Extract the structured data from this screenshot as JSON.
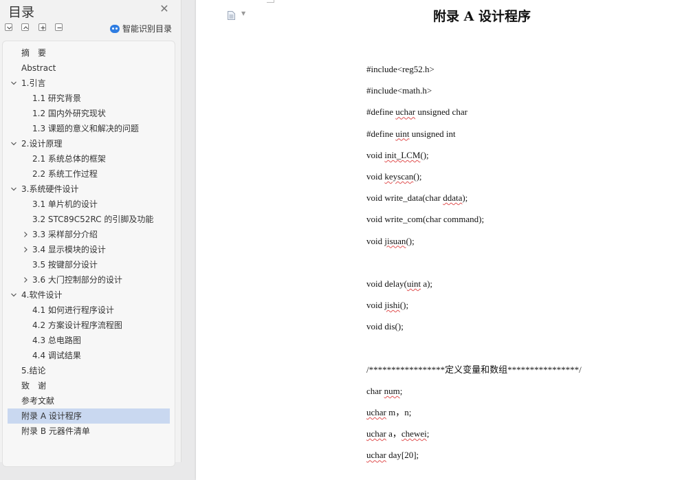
{
  "sidebar": {
    "title": "目录",
    "ai_label": "智能识别目录",
    "toc": [
      {
        "label": "摘　要",
        "level": 0,
        "chevron": ""
      },
      {
        "label": "Abstract",
        "level": 0,
        "chevron": ""
      },
      {
        "label": "1.引言",
        "level": 0,
        "chevron": "down"
      },
      {
        "label": "1.1  研究背景",
        "level": 1,
        "chevron": ""
      },
      {
        "label": "1.2  国内外研究现状",
        "level": 1,
        "chevron": ""
      },
      {
        "label": "1.3  课题的意义和解决的问题",
        "level": 1,
        "chevron": ""
      },
      {
        "label": "2.设计原理",
        "level": 0,
        "chevron": "down"
      },
      {
        "label": "2.1  系统总体的框架",
        "level": 1,
        "chevron": ""
      },
      {
        "label": "2.2  系统工作过程",
        "level": 1,
        "chevron": ""
      },
      {
        "label": "3.系统硬件设计",
        "level": 0,
        "chevron": "down"
      },
      {
        "label": "3.1  单片机的设计",
        "level": 1,
        "chevron": ""
      },
      {
        "label": "3.2 STC89C52RC 的引脚及功能",
        "level": 1,
        "chevron": ""
      },
      {
        "label": "3.3  采样部分介绍",
        "level": 1,
        "chevron": "right"
      },
      {
        "label": "3.4  显示模块的设计",
        "level": 1,
        "chevron": "right"
      },
      {
        "label": "3.5  按键部分设计",
        "level": 1,
        "chevron": ""
      },
      {
        "label": "3.6  大门控制部分的设计",
        "level": 1,
        "chevron": "right"
      },
      {
        "label": "4.软件设计",
        "level": 0,
        "chevron": "down"
      },
      {
        "label": "4.1  如何进行程序设计",
        "level": 1,
        "chevron": ""
      },
      {
        "label": "4.2  方案设计程序流程图",
        "level": 1,
        "chevron": ""
      },
      {
        "label": "4.3  总电路图",
        "level": 1,
        "chevron": ""
      },
      {
        "label": "4.4  调试结果",
        "level": 1,
        "chevron": ""
      },
      {
        "label": "5.结论",
        "level": 0,
        "chevron": ""
      },
      {
        "label": "致　谢",
        "level": 0,
        "chevron": ""
      },
      {
        "label": "参考文献",
        "level": 0,
        "chevron": ""
      },
      {
        "label": "附录 A 设计程序",
        "level": 0,
        "chevron": "",
        "selected": true
      },
      {
        "label": "附录 B 元器件清单",
        "level": 0,
        "chevron": ""
      }
    ]
  },
  "document": {
    "title": "附录 A 设计程序",
    "lines": [
      [
        {
          "t": "#include<reg52.h>"
        }
      ],
      [
        {
          "t": "#include<math.h>"
        }
      ],
      [
        {
          "t": "#define "
        },
        {
          "t": "uchar",
          "s": true
        },
        {
          "t": " unsigned char"
        }
      ],
      [
        {
          "t": "#define "
        },
        {
          "t": "uint",
          "s": true
        },
        {
          "t": " unsigned int"
        }
      ],
      [
        {
          "t": "void "
        },
        {
          "t": "init_LCM",
          "s": true
        },
        {
          "t": "();"
        }
      ],
      [
        {
          "t": "void "
        },
        {
          "t": "keyscan",
          "s": true
        },
        {
          "t": "();"
        }
      ],
      [
        {
          "t": "void write_data(char "
        },
        {
          "t": "ddata",
          "s": true
        },
        {
          "t": ");"
        }
      ],
      [
        {
          "t": "void write_com(char command);"
        }
      ],
      [
        {
          "t": "void "
        },
        {
          "t": "jisuan",
          "s": true
        },
        {
          "t": "();"
        }
      ],
      [],
      [
        {
          "t": "void delay("
        },
        {
          "t": "uint",
          "s": true
        },
        {
          "t": " a);"
        }
      ],
      [
        {
          "t": "void "
        },
        {
          "t": "jishi",
          "s": true
        },
        {
          "t": "();"
        }
      ],
      [
        {
          "t": "void dis();"
        }
      ],
      [],
      [
        {
          "t": "/*****************定义变量和数组****************/"
        }
      ],
      [
        {
          "t": "char "
        },
        {
          "t": "num",
          "s": true
        },
        {
          "t": ";"
        }
      ],
      [
        {
          "t": "uchar",
          "s": true
        },
        {
          "t": " m，n;"
        }
      ],
      [
        {
          "t": "uchar",
          "s": true
        },
        {
          "t": " a，"
        },
        {
          "t": "chewei",
          "s": true
        },
        {
          "t": ";"
        }
      ],
      [
        {
          "t": "uchar",
          "s": true
        },
        {
          "t": " day[20];"
        }
      ]
    ]
  },
  "colors": {
    "selection": "#c9d8f0",
    "ai_icon": "#2f7de1",
    "spell_underline": "#e05050"
  }
}
